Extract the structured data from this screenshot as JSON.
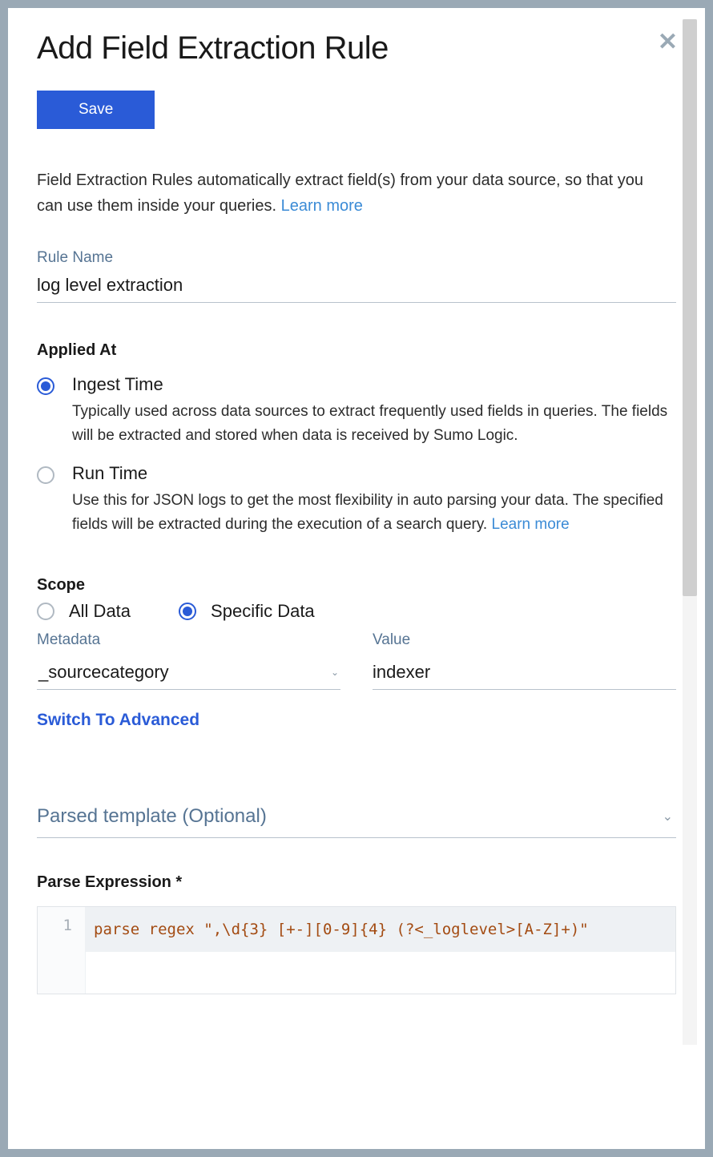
{
  "title": "Add Field Extraction Rule",
  "save_label": "Save",
  "description_pre": "Field Extraction Rules automatically extract field(s) from your data source, so that you can use them inside your queries. ",
  "description_link": "Learn more",
  "rule_name": {
    "label": "Rule Name",
    "value": "log level extraction"
  },
  "applied_at": {
    "heading": "Applied At",
    "options": [
      {
        "title": "Ingest Time",
        "desc": "Typically used across data sources to extract frequently used fields in queries. The fields will be extracted and stored when data is received by Sumo Logic.",
        "selected": true
      },
      {
        "title": "Run Time",
        "desc": "Use this for JSON logs to get the most flexibility in auto parsing your data. The specified fields will be extracted during the execution of a search query. ",
        "desc_link": "Learn more",
        "selected": false
      }
    ]
  },
  "scope": {
    "heading": "Scope",
    "options": {
      "all": "All Data",
      "specific": "Specific Data"
    },
    "selected": "specific",
    "metadata_label": "Metadata",
    "metadata_value": "_sourcecategory",
    "value_label": "Value",
    "value_value": "indexer",
    "advanced_link": "Switch To Advanced"
  },
  "parsed_template_label": "Parsed template (Optional)",
  "parse_expression": {
    "label": "Parse Expression *",
    "line_number": "1",
    "keyword": "parse regex ",
    "string": "\",\\d{3} [+-][0-9]{4} (?<_loglevel>[A-Z]+)\""
  }
}
